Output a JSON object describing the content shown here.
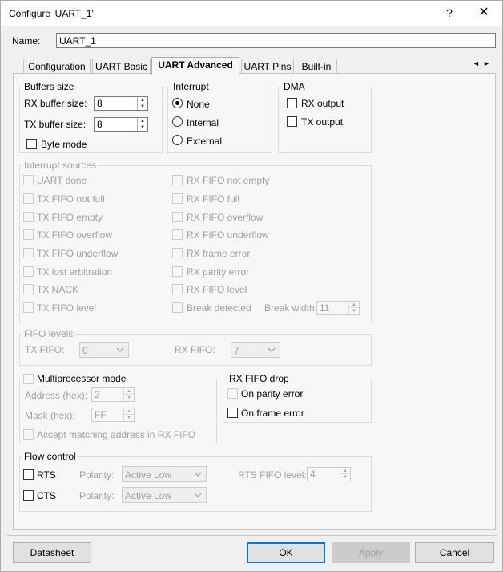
{
  "window": {
    "title": "Configure 'UART_1'",
    "help": "?",
    "close": "✕"
  },
  "name": {
    "label": "Name:",
    "value": "UART_1"
  },
  "tabs": [
    {
      "label": "Configuration"
    },
    {
      "label": "UART Basic"
    },
    {
      "label": "UART Advanced",
      "active": true
    },
    {
      "label": "UART Pins"
    },
    {
      "label": "Built-in"
    }
  ],
  "tab_scroll": {
    "left": "◄",
    "right": "►"
  },
  "buffers": {
    "title": "Buffers size",
    "rx_label": "RX buffer size:",
    "rx_value": "8",
    "tx_label": "TX buffer size:",
    "tx_value": "8",
    "byte_mode": "Byte mode"
  },
  "interrupt": {
    "title": "Interrupt",
    "options": [
      "None",
      "Internal",
      "External"
    ],
    "selected": "None"
  },
  "dma": {
    "title": "DMA",
    "rx_output": "RX output",
    "tx_output": "TX output"
  },
  "interrupt_sources": {
    "title": "Interrupt sources",
    "left": [
      "UART done",
      "TX FIFO not full",
      "TX FIFO empty",
      "TX FIFO overflow",
      "TX FIFO underflow",
      "TX lost arbitration",
      "TX NACK",
      "TX FIFO level"
    ],
    "right": [
      "RX FIFO not empty",
      "RX FIFO full",
      "RX FIFO overflow",
      "RX FIFO underflow",
      "RX frame error",
      "RX parity error",
      "RX FIFO level",
      "Break detected"
    ],
    "break_width_label": "Break width:",
    "break_width_value": "11"
  },
  "fifo_levels": {
    "title": "FIFO levels",
    "tx_label": "TX FIFO:",
    "tx_value": "0",
    "rx_label": "RX FIFO:",
    "rx_value": "7"
  },
  "multiprocessor": {
    "title": "Multiprocessor mode",
    "address_label": "Address (hex):",
    "address_value": "2",
    "mask_label": "Mask (hex):",
    "mask_value": "FF",
    "accept": "Accept matching address in RX FIFO"
  },
  "rx_fifo_drop": {
    "title": "RX FIFO drop",
    "parity": "On parity error",
    "frame": "On frame error"
  },
  "flow_control": {
    "title": "Flow control",
    "rts": "RTS",
    "cts": "CTS",
    "polarity_label": "Polarity:",
    "rts_polarity": "Active Low",
    "cts_polarity": "Active Low",
    "rts_level_label": "RTS FIFO level:",
    "rts_level_value": "4"
  },
  "buttons": {
    "datasheet": "Datasheet",
    "ok": "OK",
    "apply": "Apply",
    "cancel": "Cancel"
  }
}
